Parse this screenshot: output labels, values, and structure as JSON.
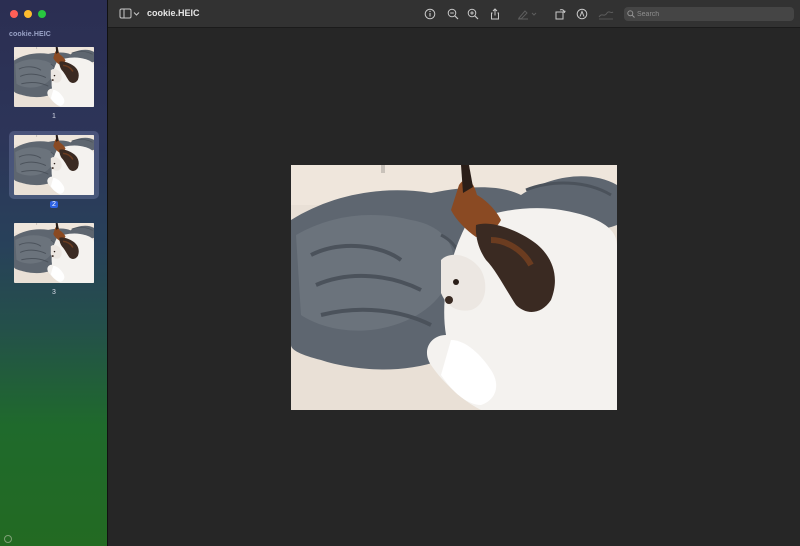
{
  "window": {
    "title": "cookie.HEIC"
  },
  "sidebar": {
    "document_name": "cookie.HEIC",
    "pages": [
      {
        "label": "1",
        "selected": false
      },
      {
        "label": "2",
        "selected": true
      },
      {
        "label": "3",
        "selected": false
      }
    ]
  },
  "toolbar": {
    "search_placeholder": "Search",
    "icons": [
      "sidebar-toggle-icon",
      "chevron-down-icon",
      "info-icon",
      "zoom-out-icon",
      "zoom-in-icon",
      "share-icon",
      "highlight-icon",
      "rotate-icon",
      "markup-icon",
      "signature-icon",
      "search-icon"
    ]
  },
  "colors": {
    "selection_accent": "#2d62e3",
    "canvas": "#262626",
    "toolbar": "#323232"
  }
}
